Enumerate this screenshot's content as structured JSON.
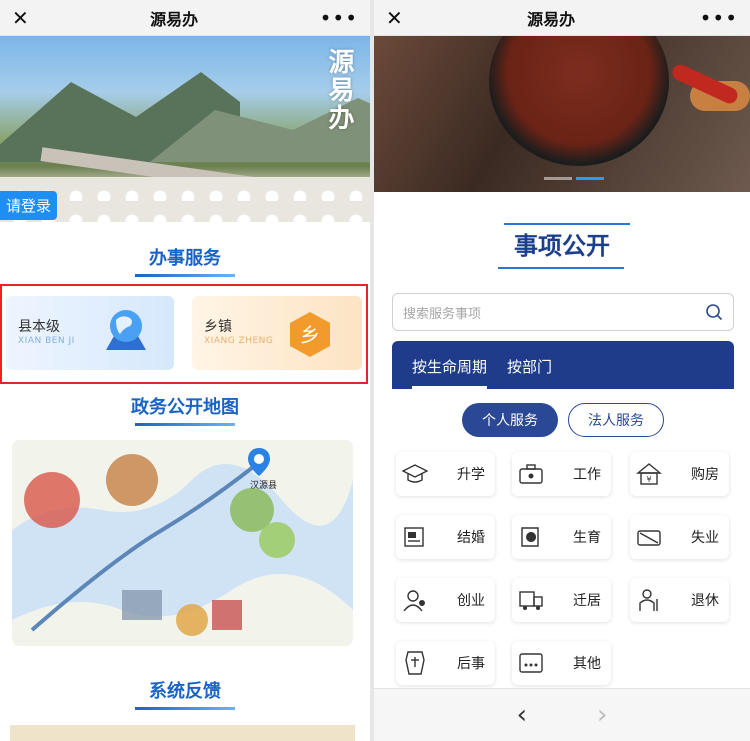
{
  "left": {
    "topbar": {
      "close_icon": "close-icon",
      "title": "源易办",
      "more_icon": "more-icon"
    },
    "banner": {
      "watermark": "源易办",
      "login_button": "请登录"
    },
    "service_section": {
      "title": "办事服务",
      "cards": [
        {
          "label": "县本级",
          "sub": "XIAN BEN JI",
          "icon": "globe-map-icon"
        },
        {
          "label": "乡镇",
          "sub": "XIANG ZHENG",
          "icon": "town-hexagon-icon",
          "icon_text": "乡"
        }
      ]
    },
    "map_section": {
      "title": "政务公开地图",
      "marker_label": "汉源县"
    },
    "feedback_section": {
      "title": "系统反馈"
    }
  },
  "right": {
    "topbar": {
      "close_icon": "close-icon",
      "title": "源易办",
      "more_icon": "more-icon"
    },
    "notice_title": "事项公开",
    "search": {
      "placeholder": "搜索服务事项"
    },
    "tabs": [
      {
        "label": "按生命周期",
        "active": true
      },
      {
        "label": "按部门",
        "active": false
      }
    ],
    "service_type": {
      "personal": "个人服务",
      "legal": "法人服务"
    },
    "items": [
      {
        "label": "升学",
        "icon": "graduation-cap-icon"
      },
      {
        "label": "工作",
        "icon": "briefcase-icon"
      },
      {
        "label": "购房",
        "icon": "house-icon"
      },
      {
        "label": "结婚",
        "icon": "marriage-certificate-icon"
      },
      {
        "label": "生育",
        "icon": "baby-icon"
      },
      {
        "label": "失业",
        "icon": "unemployment-icon"
      },
      {
        "label": "创业",
        "icon": "entrepreneur-icon"
      },
      {
        "label": "迁居",
        "icon": "moving-truck-icon"
      },
      {
        "label": "退休",
        "icon": "retirement-icon"
      },
      {
        "label": "后事",
        "icon": "funeral-icon"
      },
      {
        "label": "其他",
        "icon": "other-icon"
      }
    ],
    "bottom_nav": {
      "back": "‹",
      "forward": "›"
    }
  },
  "colors": {
    "primary_blue": "#1e3c8a",
    "section_blue": "#1a63c6",
    "highlight_red": "#e8232a",
    "login_blue": "#1f8ef3"
  }
}
